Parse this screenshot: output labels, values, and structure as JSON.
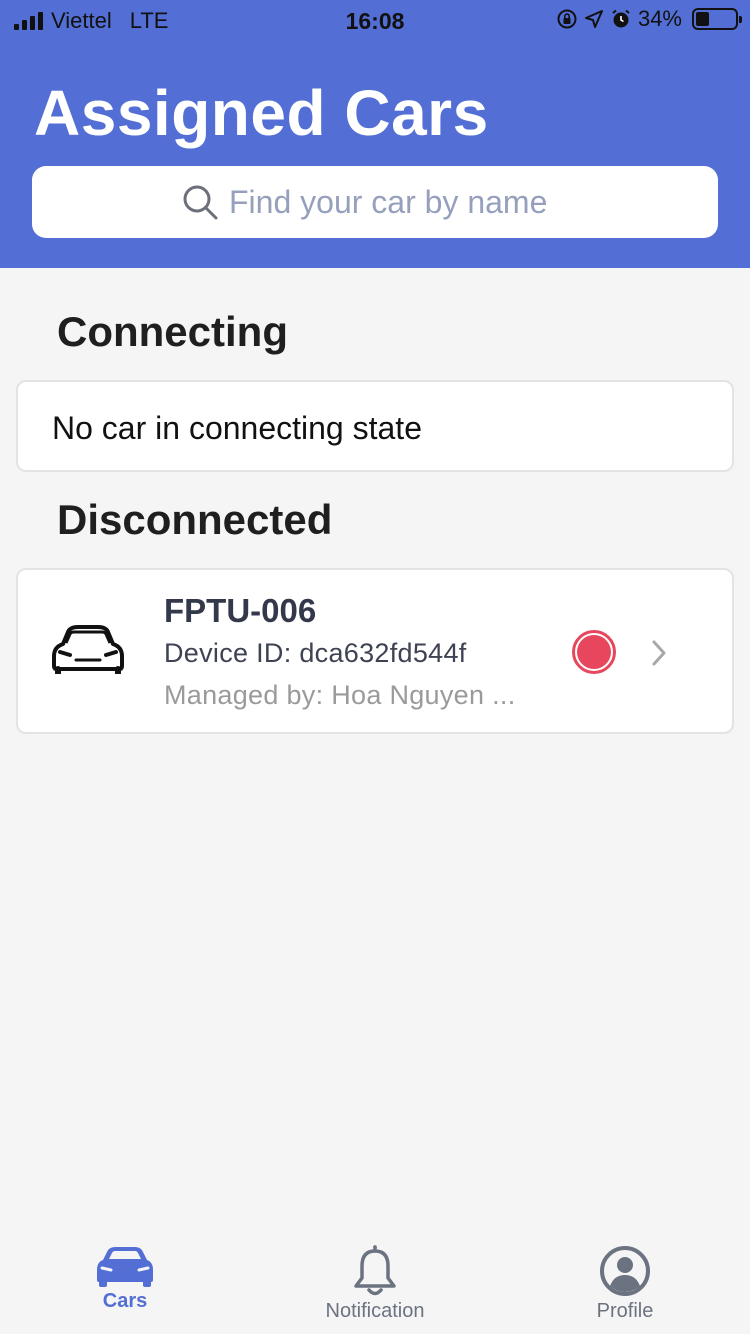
{
  "status_bar": {
    "carrier": "Viettel",
    "network": "LTE",
    "time": "16:08",
    "battery": "34%",
    "battery_level": 0.34
  },
  "header": {
    "title": "Assigned Cars",
    "search": {
      "placeholder": "Find your car by name",
      "icon": "search-icon"
    },
    "background": "#536fd5"
  },
  "sections": {
    "connecting": {
      "title": "Connecting",
      "empty_text": "No car in connecting state"
    },
    "disconnected": {
      "title": "Disconnected",
      "cars": [
        {
          "name": "FPTU-006",
          "device_id": "Device ID: dca632fd544f",
          "managed_by": "Managed by: Hoa Nguyen ...",
          "status_color": "#e8465c",
          "icon": "car-icon"
        }
      ]
    }
  },
  "tabbar": {
    "tabs": [
      {
        "label": "Cars",
        "icon": "car-icon",
        "active": true,
        "color": "#536fd5"
      },
      {
        "label": "Notification",
        "icon": "bell-icon",
        "active": false,
        "color": "#6b7280"
      },
      {
        "label": "Profile",
        "icon": "user-circle-icon",
        "active": false,
        "color": "#6b7280"
      }
    ]
  }
}
